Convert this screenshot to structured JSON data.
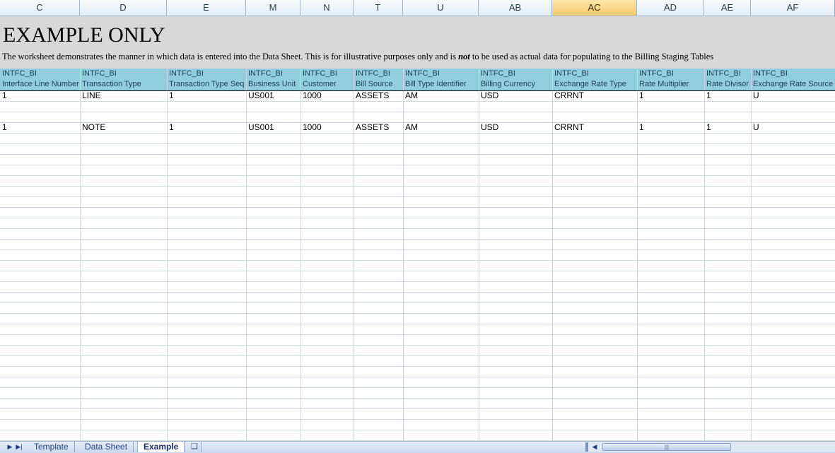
{
  "columns": [
    "C",
    "D",
    "E",
    "M",
    "N",
    "T",
    "U",
    "AB",
    "AC",
    "AD",
    "AE",
    "AF"
  ],
  "selected_column": "AC",
  "banner": {
    "title": "EXAMPLE ONLY",
    "desc_before": "The worksheet demonstrates the manner in which data is entered into the Data Sheet. This is for illustrative purposes only and is ",
    "desc_emphasis": "not",
    "desc_after": " to be used as actual data for populating to the Billing Staging Tables"
  },
  "header_row1": [
    "INTFC_BI",
    "INTFC_BI",
    "INTFC_BI",
    "INTFC_BI",
    "INTFC_BI",
    "INTFC_BI",
    "INTFC_BI",
    "INTFC_BI",
    "INTFC_BI",
    "INTFC_BI",
    "INTFC_BI",
    "INTFC_BI"
  ],
  "header_row2": [
    "Interface Line Number",
    "Transaction Type",
    "Transaction Type Seq",
    "Business Unit",
    "Customer",
    "Bill Source",
    "Bill Type Identifier",
    "Billing Currency",
    "Exchange Rate Type",
    "Rate Multiplier",
    "Rate Divisor",
    "Exchange Rate Source"
  ],
  "rows": [
    [
      "1",
      "LINE",
      "1",
      "US001",
      "1000",
      "ASSETS",
      "AM",
      "USD",
      "CRRNT",
      "1",
      "1",
      "U"
    ],
    [
      "1",
      "NOTE",
      "1",
      "US001",
      "1000",
      "ASSETS",
      "AM",
      "USD",
      "CRRNT",
      "1",
      "1",
      "U"
    ]
  ],
  "sheet_tabs": [
    {
      "label": "Template",
      "active": false
    },
    {
      "label": "Data Sheet",
      "active": false
    },
    {
      "label": "Example",
      "active": true
    }
  ]
}
